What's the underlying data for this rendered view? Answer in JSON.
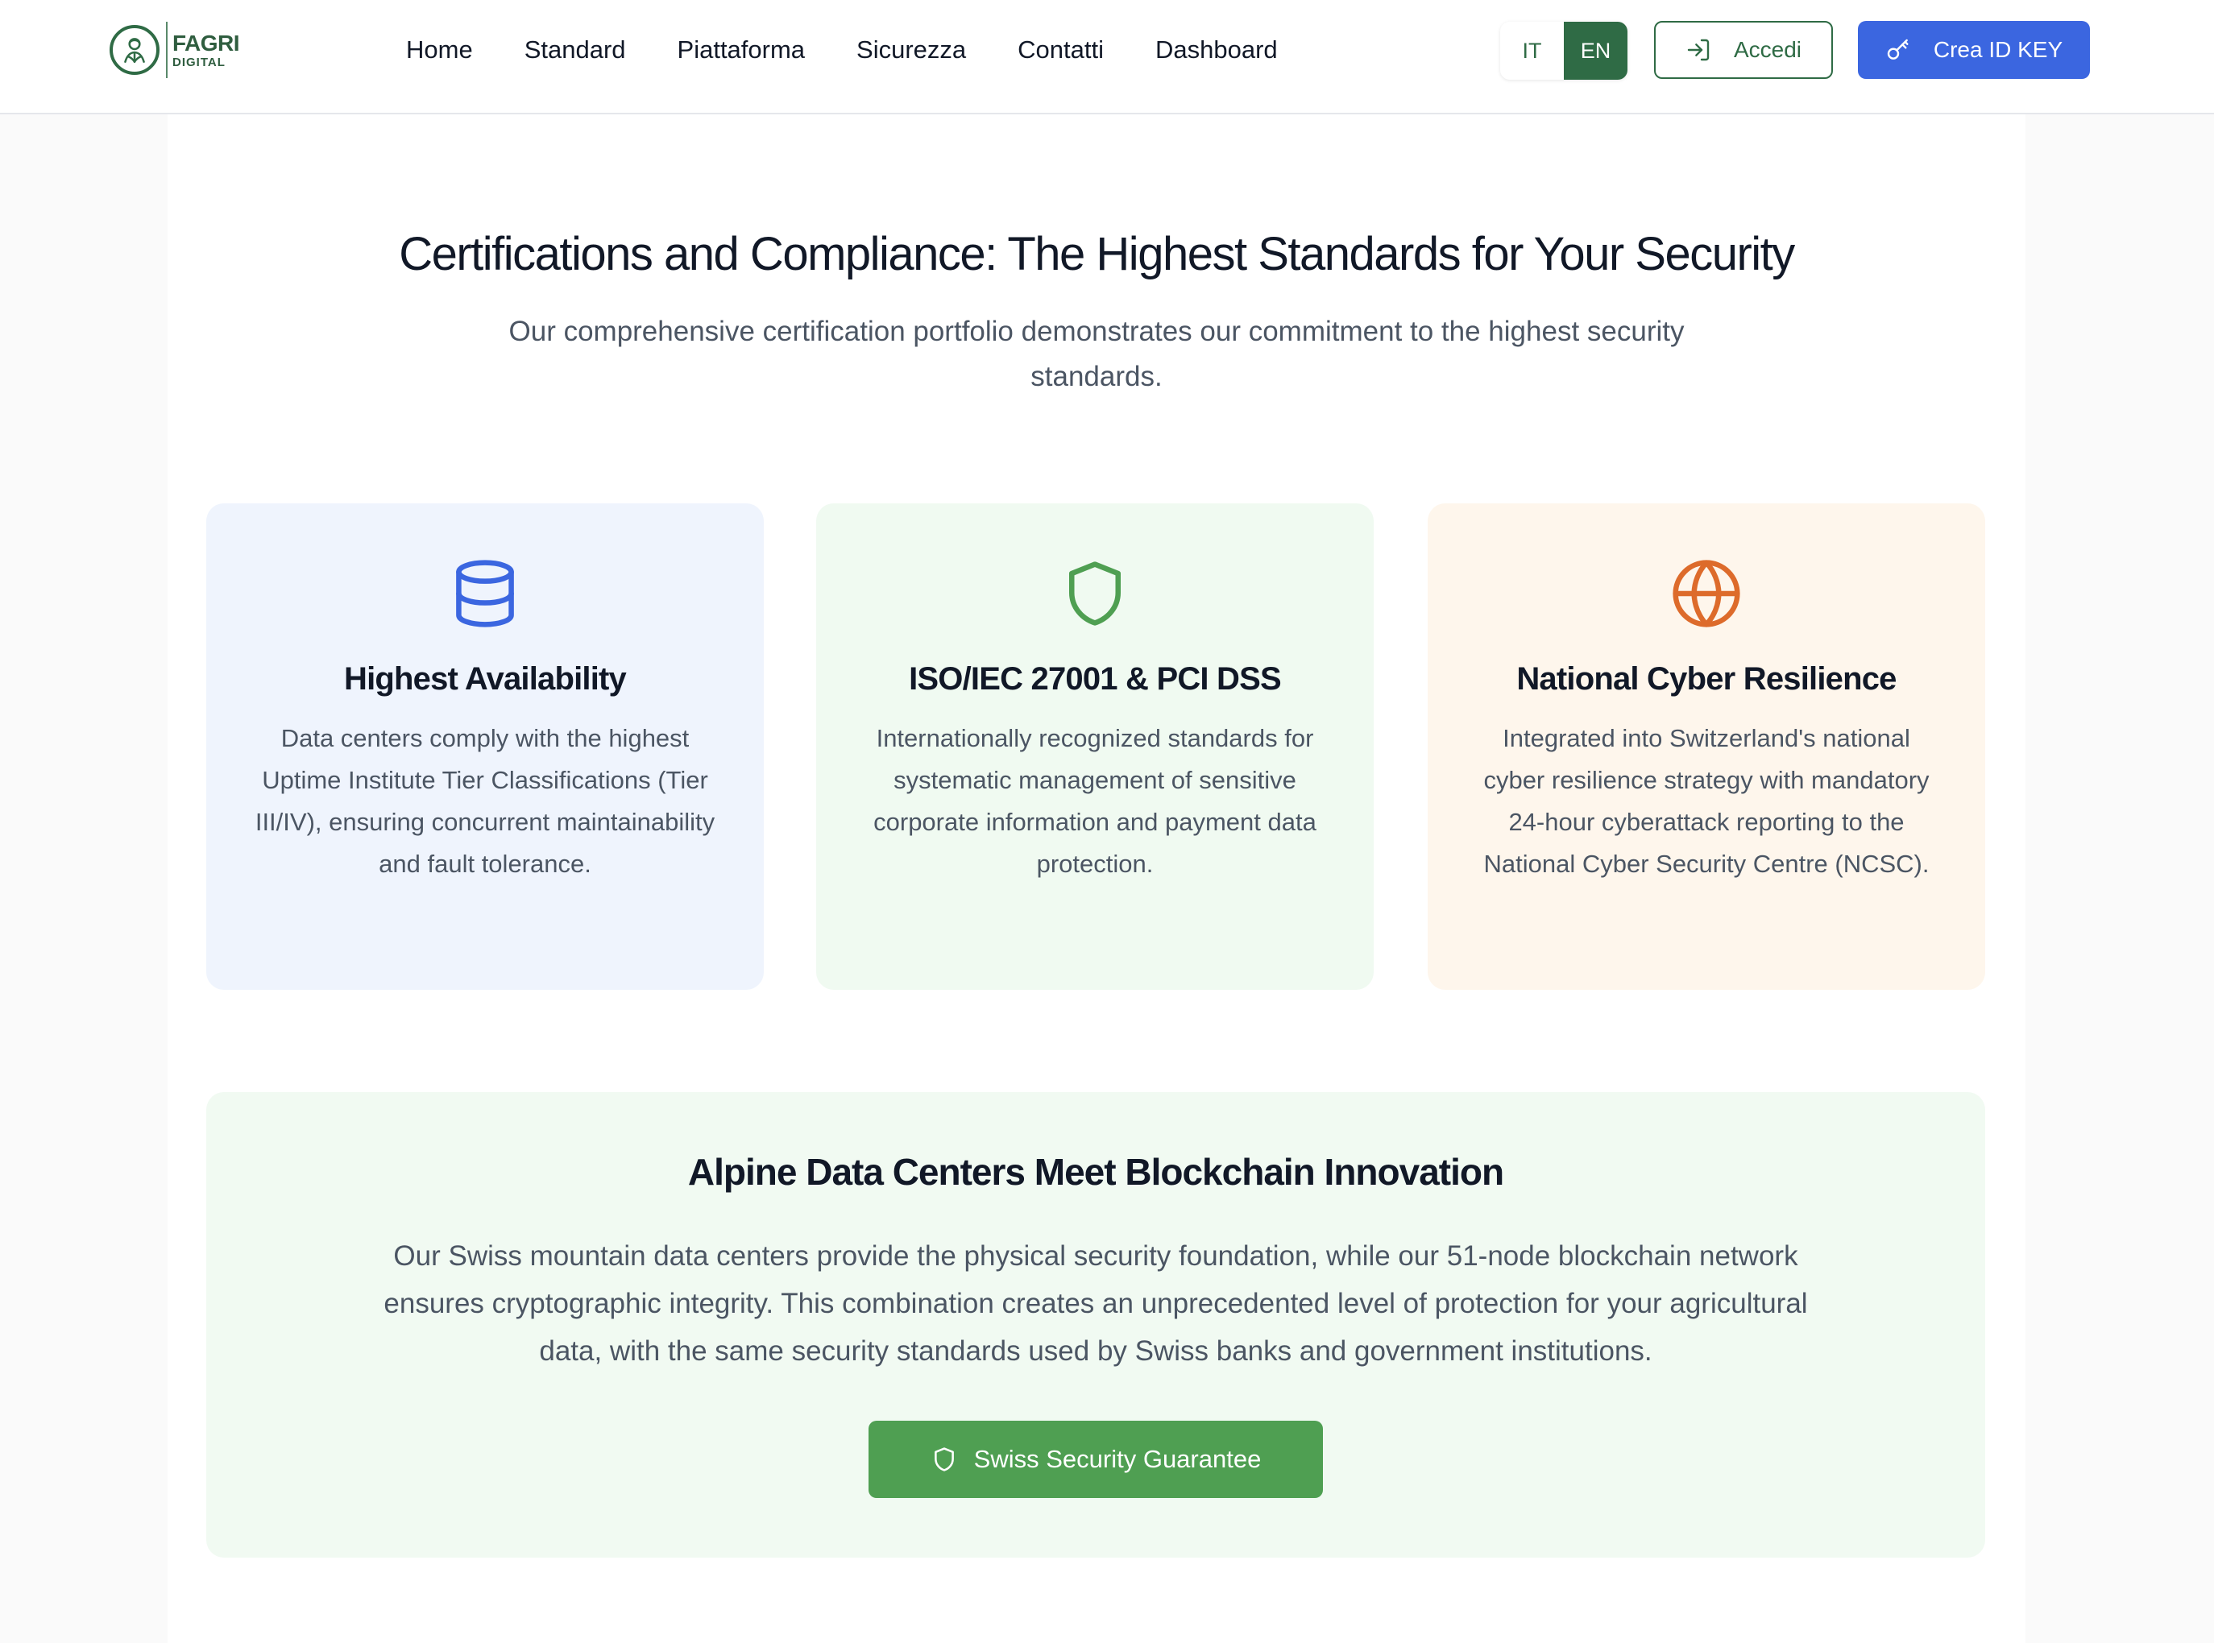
{
  "header": {
    "logo": {
      "line1": "FAGRI",
      "line2": "DIGITAL"
    },
    "nav": [
      "Home",
      "Standard",
      "Piattaforma",
      "Sicurezza",
      "Contatti",
      "Dashboard"
    ],
    "languages": [
      {
        "code": "IT",
        "active": false
      },
      {
        "code": "EN",
        "active": true
      }
    ],
    "login_label": "Accedi",
    "create_key_label": "Crea ID KEY"
  },
  "hero": {
    "title": "Certifications and Compliance: The Highest Standards for Your Security",
    "subtitle": "Our comprehensive certification portfolio demonstrates our commitment to the highest security standards."
  },
  "cards": [
    {
      "icon": "database-icon",
      "accent": "#3b66e0",
      "background": "#eff4fd",
      "title": "Highest Availability",
      "body": "Data centers comply with the highest Uptime Institute Tier Classifications (Tier III/IV), ensuring concurrent maintainability and fault tolerance."
    },
    {
      "icon": "shield-icon",
      "accent": "#4f9f52",
      "background": "#f0faf1",
      "title": "ISO/IEC 27001 & PCI DSS",
      "body": "Internationally recognized standards for systematic management of sensitive corporate information and payment data protection."
    },
    {
      "icon": "globe-icon",
      "accent": "#dd6b2b",
      "background": "#fef6ec",
      "title": "National Cyber Resilience",
      "body": "Integrated into Switzerland's national cyber resilience strategy with mandatory 24-hour cyberattack reporting to the National Cyber Security Centre (NCSC)."
    }
  ],
  "banner": {
    "title": "Alpine Data Centers Meet Blockchain Innovation",
    "body": "Our Swiss mountain data centers provide the physical security foundation, while our 51-node blockchain network ensures cryptographic integrity. This combination creates an unprecedented level of protection for your agricultural data, with the same security standards used by Swiss banks and government institutions.",
    "button_label": "Swiss Security Guarantee",
    "button_icon": "shield-icon"
  },
  "colors": {
    "brand_green": "#2f6b45",
    "primary_blue": "#3b66e0",
    "cta_green": "#4f9f52"
  }
}
